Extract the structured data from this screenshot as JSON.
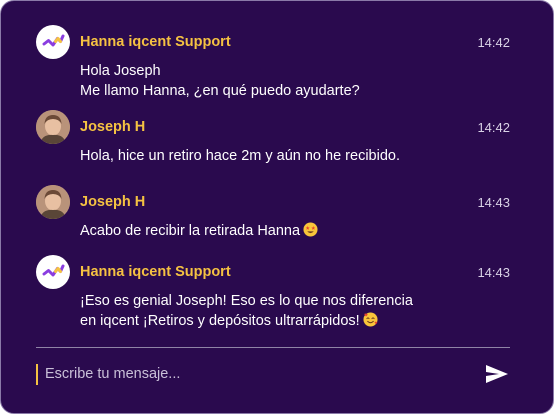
{
  "messages": [
    {
      "sender": "Hanna iqcent Support",
      "time": "14:42",
      "avatar": "brand-logo",
      "lines": [
        "Hola Joseph",
        "Me llamo Hanna, ¿en qué puedo ayudarte?"
      ]
    },
    {
      "sender": "Joseph H",
      "time": "14:42",
      "avatar": "user-photo",
      "lines": [
        "Hola, hice un retiro hace 2m y aún no he recibido."
      ]
    },
    {
      "sender": "Joseph H",
      "time": "14:43",
      "avatar": "user-photo",
      "lines": [
        "Acabo de recibir la retirada Hanna"
      ],
      "emoji": "star-struck-emoji"
    },
    {
      "sender": "Hanna iqcent Support",
      "time": "14:43",
      "avatar": "brand-logo",
      "lines": [
        "¡Eso es genial Joseph! Eso es lo que nos diferencia",
        "en iqcent ¡Retiros y depósitos ultrarrápidos!"
      ],
      "emoji": "smiling-face-with-hearts-emoji"
    }
  ],
  "composer": {
    "placeholder": "Escribe tu mensaje...",
    "send_icon": "send-icon"
  },
  "colors": {
    "background": "#2a0a4e",
    "sender_name": "#f5c242",
    "text": "#ffffff",
    "caret": "#f5c242"
  }
}
